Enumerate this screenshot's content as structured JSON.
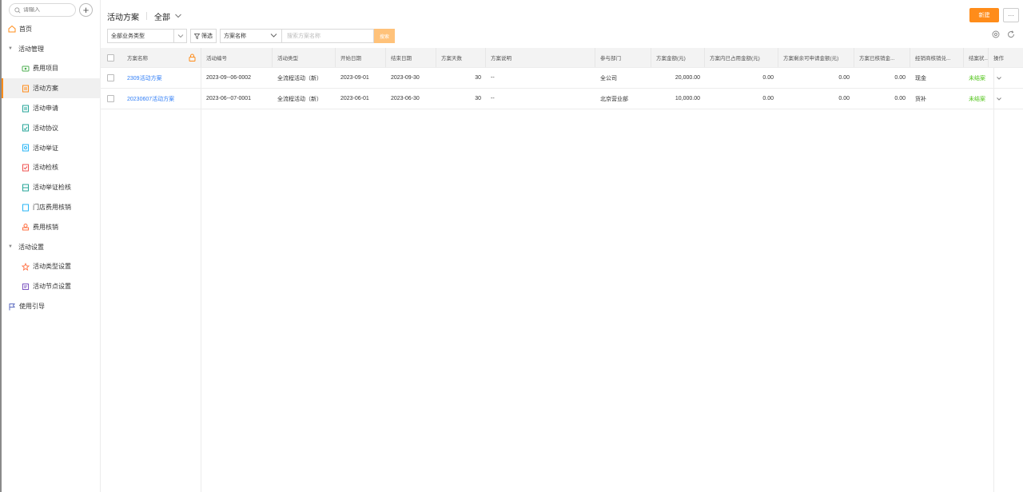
{
  "sidebar": {
    "search_placeholder": "请输入",
    "add_label": "+",
    "items": [
      {
        "label": "首页"
      },
      {
        "label": "活动管理"
      },
      {
        "label": "费用项目"
      },
      {
        "label": "活动方案"
      },
      {
        "label": "活动申请"
      },
      {
        "label": "活动协议"
      },
      {
        "label": "活动举证"
      },
      {
        "label": "活动检核"
      },
      {
        "label": "活动举证检核"
      },
      {
        "label": "门店费用核销"
      },
      {
        "label": "费用核销"
      },
      {
        "label": "活动设置"
      },
      {
        "label": "活动类型设置"
      },
      {
        "label": "活动节点设置"
      },
      {
        "label": "使用引导"
      }
    ]
  },
  "header": {
    "title": "活动方案",
    "scope": "全部",
    "new_label": "新建",
    "more_label": "···"
  },
  "filters": {
    "biz_type": "全部业务类型",
    "filter_label": "筛选",
    "field": "方案名称",
    "keyword_placeholder": "搜索方案名称",
    "search_label": "搜索"
  },
  "table": {
    "headers": [
      "方案名称",
      "活动编号",
      "活动类型",
      "开始日期",
      "结束日期",
      "方案天数",
      "方案说明",
      "参与部门",
      "方案金额(元)",
      "方案内已占用金额(元)",
      "方案剩余可申请金额(元)",
      "方案已核销金...",
      "经销商核销兑...",
      "结案状...",
      "操作"
    ],
    "rows": [
      [
        "2309活动方案",
        "2023-09--06-0002",
        "全流程活动（新）",
        "2023-09-01",
        "2023-09-30",
        "30",
        "--",
        "全公司",
        "20,000.00",
        "0.00",
        "0.00",
        "0.00",
        "现金",
        "未结案"
      ],
      [
        "20230607活动方案",
        "2023-06--07-0001",
        "全流程活动（新）",
        "2023-06-01",
        "2023-06-30",
        "30",
        "--",
        "北京营业部",
        "10,000.00",
        "0.00",
        "0.00",
        "0.00",
        "货补",
        "未结案"
      ]
    ]
  },
  "colors": {
    "accent": "#ff8c1a",
    "link": "#2f7df6",
    "status_open": "#52c41a"
  }
}
